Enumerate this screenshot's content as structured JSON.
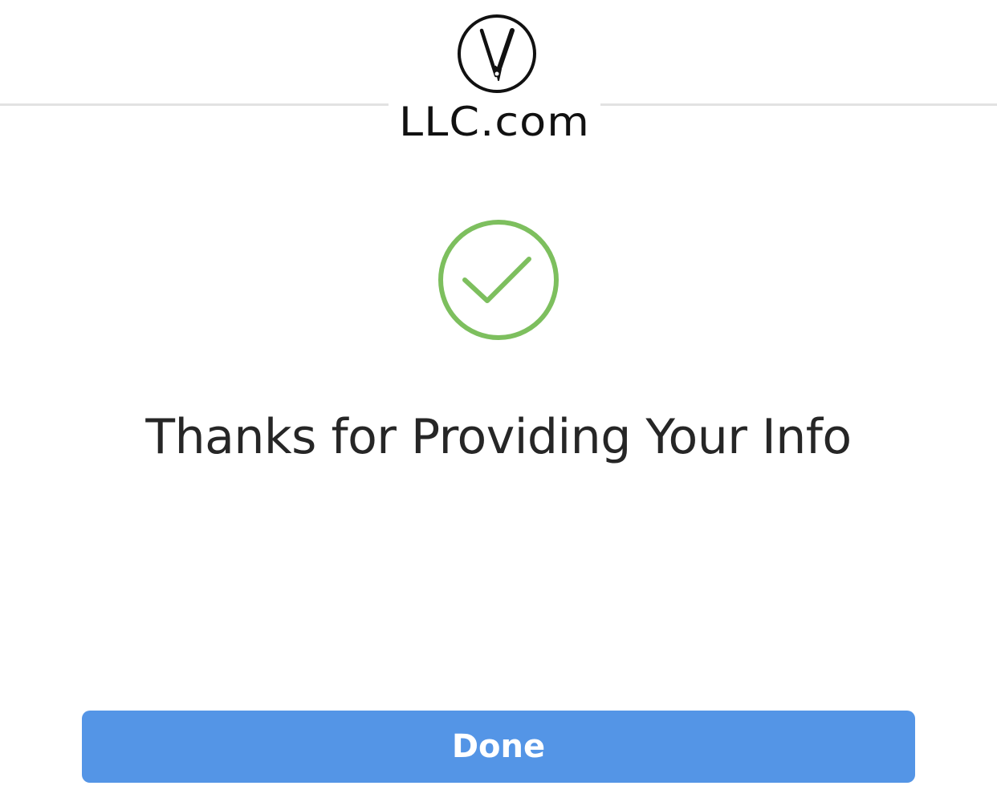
{
  "header": {
    "logo_text": "LLC.com",
    "logo_mark_icon": "razor-v-circle-logo"
  },
  "confirmation": {
    "icon": "check-circle-icon",
    "icon_color": "#7dbf5e",
    "message": "Thanks for Providing Your Info"
  },
  "actions": {
    "done_label": "Done",
    "done_color": "#5495e6"
  }
}
